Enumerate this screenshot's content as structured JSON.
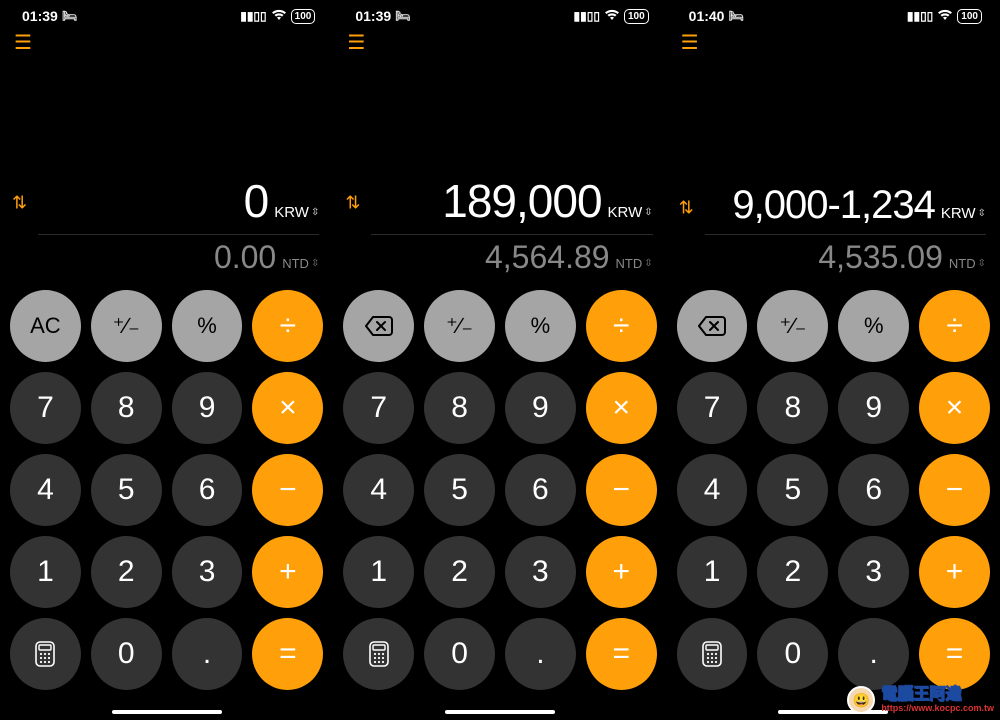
{
  "screens": [
    {
      "status": {
        "time": "01:39",
        "battery": "100"
      },
      "primary": {
        "value": "0",
        "unit": "KRW"
      },
      "secondary": {
        "value": "0.00",
        "unit": "NTD"
      },
      "clearLabel": "AC",
      "clearIsBackspace": false
    },
    {
      "status": {
        "time": "01:39",
        "battery": "100"
      },
      "primary": {
        "value": "189,000",
        "unit": "KRW"
      },
      "secondary": {
        "value": "4,564.89",
        "unit": "NTD"
      },
      "clearLabel": "",
      "clearIsBackspace": true
    },
    {
      "status": {
        "time": "01:40",
        "battery": "100"
      },
      "primary": {
        "value": "9,000-1,234",
        "unit": "KRW"
      },
      "secondary": {
        "value": "4,535.09",
        "unit": "NTD"
      },
      "clearLabel": "",
      "clearIsBackspace": true
    }
  ],
  "keys": {
    "plusminus": "⁺∕₋",
    "percent": "%",
    "divide": "÷",
    "multiply": "×",
    "minus": "−",
    "plus": "+",
    "equals": "=",
    "d7": "7",
    "d8": "8",
    "d9": "9",
    "d4": "4",
    "d5": "5",
    "d6": "6",
    "d1": "1",
    "d2": "2",
    "d3": "3",
    "d0": "0",
    "dot": "."
  },
  "watermark": {
    "title": "電腦王阿達",
    "url": "https://www.kocpc.com.tw"
  }
}
